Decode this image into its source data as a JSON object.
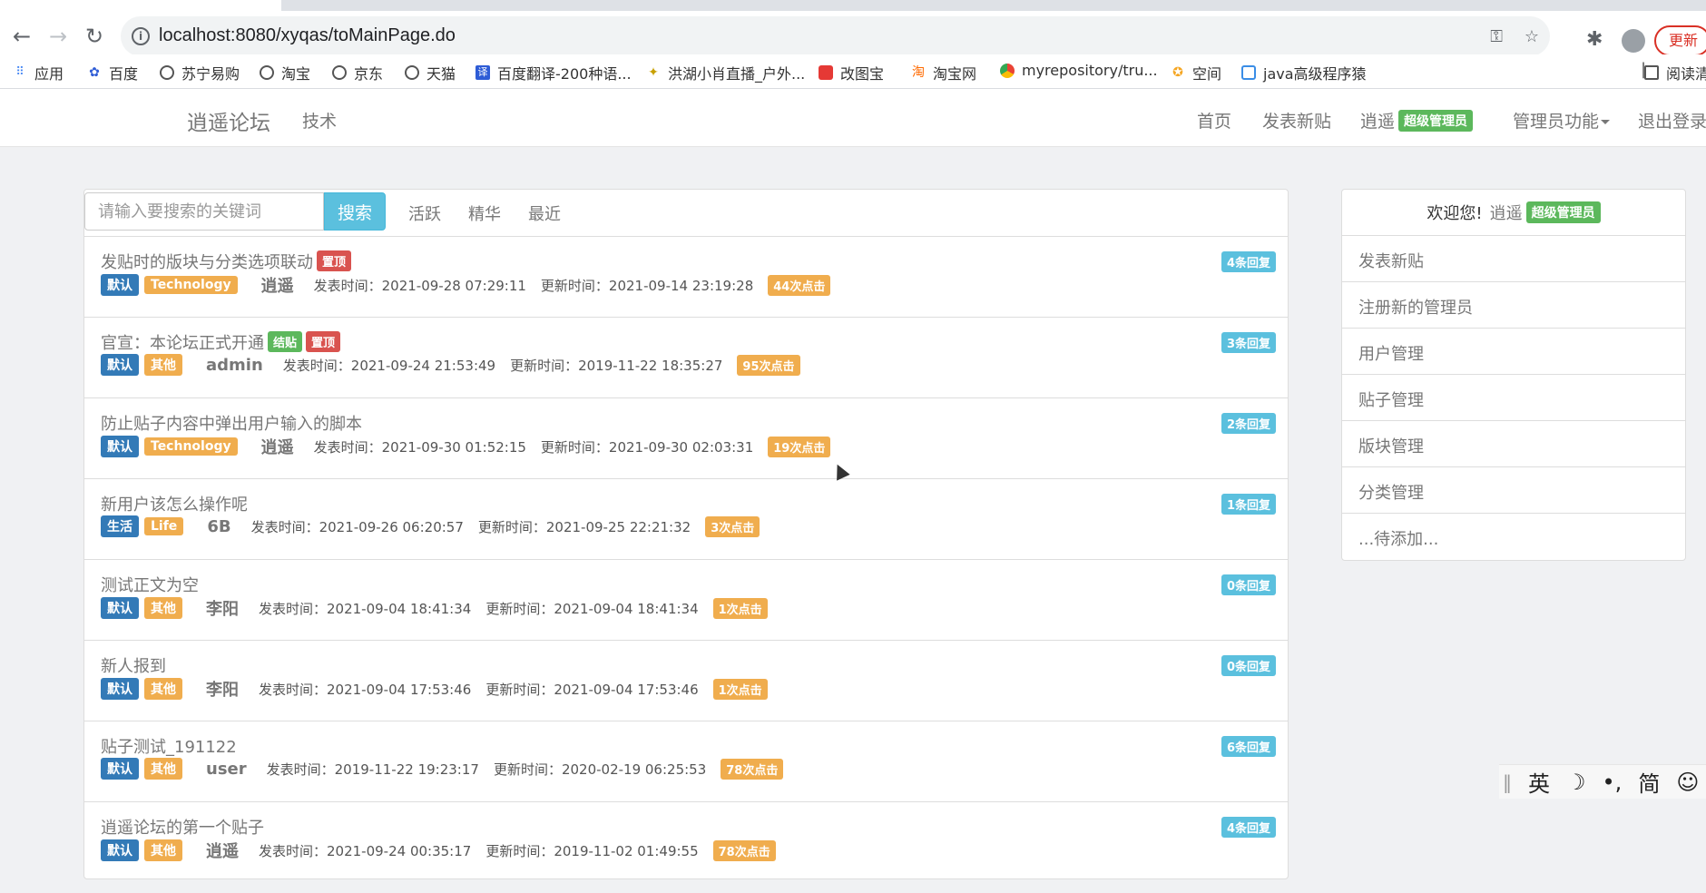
{
  "browser": {
    "url": "localhost:8080/xyqas/toMainPage.do",
    "update_label": "更新",
    "bookmarks": [
      {
        "label": "应用",
        "icon": "apps-grid-icon"
      },
      {
        "label": "百度",
        "icon": "baidu-paw-icon"
      },
      {
        "label": "苏宁易购",
        "icon": "globe-icon"
      },
      {
        "label": "淘宝",
        "icon": "globe-icon"
      },
      {
        "label": "京东",
        "icon": "globe-icon"
      },
      {
        "label": "天猫",
        "icon": "globe-icon"
      },
      {
        "label": "百度翻译-200种语...",
        "icon": "translate-icon"
      },
      {
        "label": "洪湖小肖直播_户外...",
        "icon": "bee-icon"
      },
      {
        "label": "改图宝",
        "icon": "red-square-icon"
      },
      {
        "label": "淘宝网",
        "icon": "taobao-icon"
      },
      {
        "label": "myrepository/tru...",
        "icon": "chrome-icon"
      },
      {
        "label": "空间",
        "icon": "qzone-icon"
      },
      {
        "label": "java高级程序猿",
        "icon": "bilibili-tv-icon"
      },
      {
        "label": "阅读清",
        "icon": "reading-list-icon"
      }
    ]
  },
  "navbar": {
    "brand": "逍遥论坛",
    "tech_link": "技术",
    "home": "首页",
    "new_post": "发表新贴",
    "username": "逍遥",
    "role_badge": "超级管理员",
    "admin_menu": "管理员功能",
    "logout": "退出登录"
  },
  "search": {
    "placeholder": "请输入要搜索的关键词",
    "button": "搜索",
    "tabs": [
      "活跃",
      "精华",
      "最近"
    ]
  },
  "posts": [
    {
      "title": "发贴时的版块与分类选项联动",
      "labels": [
        "置顶"
      ],
      "section": "默认",
      "category": "Technology",
      "author": "逍遥",
      "post_time": "发表时间：2021-09-28 07:29:11",
      "update_time": "更新时间：2021-09-14 23:19:28",
      "clicks": "44次点击",
      "replies": "4条回复"
    },
    {
      "title": "官宣：本论坛正式开通",
      "labels": [
        "结贴",
        "置顶"
      ],
      "section": "默认",
      "category": "其他",
      "author": "admin",
      "post_time": "发表时间：2021-09-24 21:53:49",
      "update_time": "更新时间：2019-11-22 18:35:27",
      "clicks": "95次点击",
      "replies": "3条回复"
    },
    {
      "title": "防止贴子内容中弹出用户输入的脚本",
      "labels": [],
      "section": "默认",
      "category": "Technology",
      "author": "逍遥",
      "post_time": "发表时间：2021-09-30 01:52:15",
      "update_time": "更新时间：2021-09-30 02:03:31",
      "clicks": "19次点击",
      "replies": "2条回复"
    },
    {
      "title": "新用户该怎么操作呢",
      "labels": [],
      "section": "生活",
      "category": "Life",
      "author": "6B",
      "post_time": "发表时间：2021-09-26 06:20:57",
      "update_time": "更新时间：2021-09-25 22:21:32",
      "clicks": "3次点击",
      "replies": "1条回复"
    },
    {
      "title": "测试正文为空",
      "labels": [],
      "section": "默认",
      "category": "其他",
      "author": "李阳",
      "post_time": "发表时间：2021-09-04 18:41:34",
      "update_time": "更新时间：2021-09-04 18:41:34",
      "clicks": "1次点击",
      "replies": "0条回复"
    },
    {
      "title": "新人报到",
      "labels": [],
      "section": "默认",
      "category": "其他",
      "author": "李阳",
      "post_time": "发表时间：2021-09-04 17:53:46",
      "update_time": "更新时间：2021-09-04 17:53:46",
      "clicks": "1次点击",
      "replies": "0条回复"
    },
    {
      "title": "贴子测试_191122",
      "labels": [],
      "section": "默认",
      "category": "其他",
      "author": "user",
      "post_time": "发表时间：2019-11-22 19:23:17",
      "update_time": "更新时间：2020-02-19 06:25:53",
      "clicks": "78次点击",
      "replies": "6条回复"
    },
    {
      "title": "逍遥论坛的第一个贴子",
      "labels": [],
      "section": "默认",
      "category": "其他",
      "author": "逍遥",
      "post_time": "发表时间：2021-09-24 00:35:17",
      "update_time": "更新时间：2019-11-02 01:49:55",
      "clicks": "78次点击",
      "replies": "4条回复"
    }
  ],
  "sidebar": {
    "welcome": "欢迎您!",
    "username": "逍遥",
    "role_badge": "超级管理员",
    "items": [
      "发表新贴",
      "注册新的管理员",
      "用户管理",
      "贴子管理",
      "版块管理",
      "分类管理",
      "...待添加..."
    ]
  },
  "ime": {
    "items": [
      "英",
      "☽",
      "•,",
      "简",
      "☺"
    ]
  },
  "colors": {
    "primary": "#337ab7",
    "info": "#5bc0de",
    "warning": "#f0ad4e",
    "danger": "#d9534f",
    "success": "#5cb85c"
  }
}
